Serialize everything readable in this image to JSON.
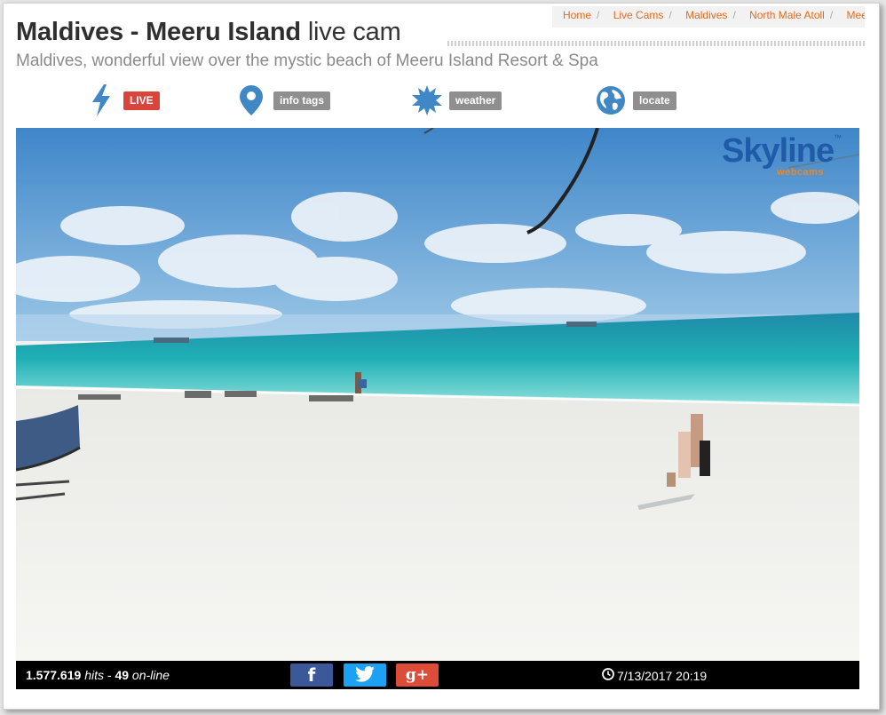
{
  "breadcrumb": {
    "items": [
      "Home",
      "Live Cams",
      "Maldives",
      "North Male Atoll",
      "Meerufenfushi"
    ]
  },
  "header": {
    "title_bold": "Maldives - Meeru Island",
    "title_light": "live cam",
    "subtitle": "Maldives, wonderful view over the mystic beach of Meeru Island Resort & Spa"
  },
  "toolbar": {
    "live": {
      "icon": "lightning-icon",
      "label": "LIVE"
    },
    "info": {
      "icon": "map-pin-icon",
      "label": "info tags"
    },
    "weather": {
      "icon": "sun-icon",
      "label": "weather"
    },
    "locate": {
      "icon": "globe-icon",
      "label": "locate"
    }
  },
  "webcam": {
    "brand_name": "Skyline",
    "brand_tm": "™",
    "brand_sub": "webcams"
  },
  "footer": {
    "hits": "1.577.619",
    "hits_label": "hits",
    "separator": "-",
    "online": "49",
    "online_label": "on-line",
    "social": {
      "facebook": "f",
      "twitter_icon": "twitter-bird-icon",
      "googleplus": "g+"
    },
    "timestamp": "7/13/2017 20:19"
  },
  "colors": {
    "accent_orange": "#e66a1f",
    "live_red": "#d9453c",
    "icon_blue": "#3f88c5",
    "facebook": "#3b5998",
    "twitter": "#1da1f2",
    "googleplus": "#dd4b39"
  }
}
